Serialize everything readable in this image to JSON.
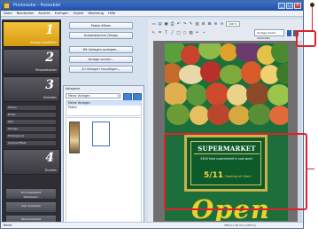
{
  "window": {
    "title": "Printmaster - Posterbild",
    "controls": [
      "_",
      "□",
      "×"
    ]
  },
  "menu": [
    "Datei",
    "Bearbeiten",
    "Ansicht",
    "Einfügen",
    "Objekt",
    "Werkzeug",
    "Hilfe"
  ],
  "steps": [
    {
      "num": "1",
      "label": "Vorlage auswählen",
      "active": true
    },
    {
      "num": "2",
      "label": "Personalisieren",
      "active": false
    },
    {
      "num": "3",
      "label": "Gestalten",
      "active": false
    },
    {
      "num": "4",
      "label": "Drucken",
      "active": false
    }
  ],
  "step3_subitems": [
    "Farben",
    "Bilder",
    "Text",
    "Formen",
    "Hintergrund",
    "Spezial-Effekt"
  ],
  "bottom_buttons": [
    {
      "line1": "Druckassistent",
      "line2": "Verbessern"
    },
    {
      "line1": "User anpassen",
      "line2": ""
    },
    {
      "line1": "Personalisierte",
      "line2": "Einstellungen"
    }
  ],
  "center_buttons": [
    "Poster öffnen",
    "Automatisches Design",
    "Mit Vorlagen anzeigen...",
    "Vorlage suchen...",
    "Zu Vorlagen hinzufügen..."
  ],
  "template_panel": {
    "header": "Kategorie",
    "select_value": "Meine Vorlagen",
    "list": [
      "Meine Vorlagen",
      "Poster"
    ]
  },
  "toolbar": {
    "zoom": "100 %",
    "font_dropdown": "Vorlage direkt verbinden"
  },
  "poster": {
    "title": "SUPERMARKET",
    "subtitle": "XXXX food supermarket is now open!",
    "date": "5/11",
    "time": "Opening at 10am",
    "big_text": "Open"
  },
  "status": {
    "left": "Bereit",
    "right": "356.0 x 42 mm (100 %)"
  },
  "colors": {
    "accent": "#e0202a",
    "poster_bg": "#1c6e3a",
    "gold": "#c9b24a",
    "step_active": "#e8b022"
  }
}
